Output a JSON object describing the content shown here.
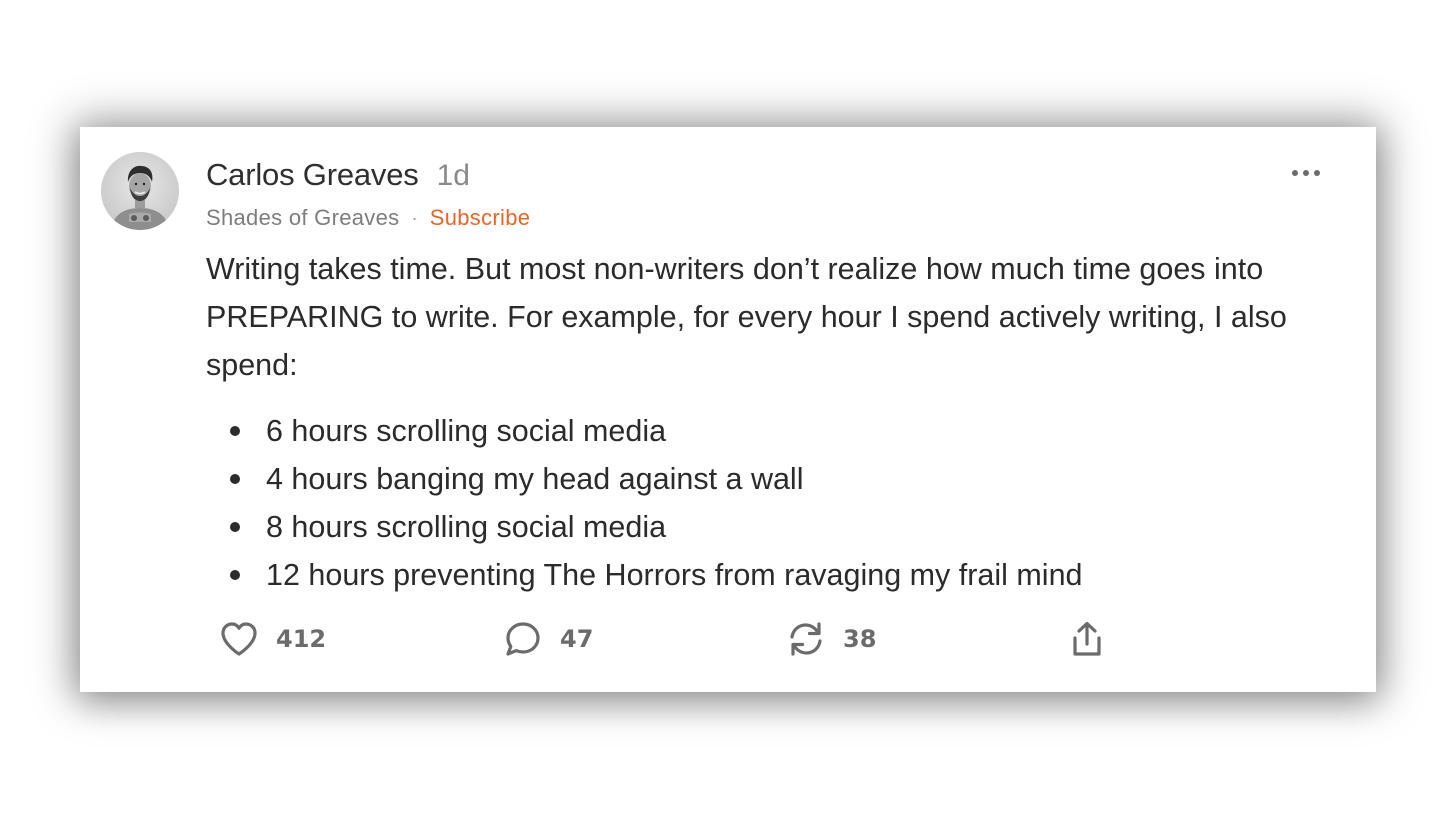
{
  "post": {
    "author": "Carlos Greaves",
    "time": "1d",
    "publication": "Shades of Greaves",
    "separator": "·",
    "subscribe_label": "Subscribe",
    "body": "Writing takes time. But most non-writers don’t realize how much time goes into PREPARING to write. For example, for every hour I spend actively writing, I also spend:",
    "bullets": [
      "6 hours scrolling social media",
      "4 hours banging my head against a wall",
      "8 hours scrolling social media",
      "12 hours preventing The Horrors from ravaging my frail mind"
    ]
  },
  "actions": {
    "likes": "412",
    "comments": "47",
    "restacks": "38"
  },
  "icons": {
    "more": "more-horizontal-icon",
    "like": "heart-icon",
    "comment": "comment-bubble-icon",
    "restack": "restack-arrows-icon",
    "share": "share-icon"
  },
  "colors": {
    "accent": "#e8662a",
    "text": "#2b2b2b",
    "muted": "#7d7d7d",
    "icon": "#6b6b6b"
  }
}
